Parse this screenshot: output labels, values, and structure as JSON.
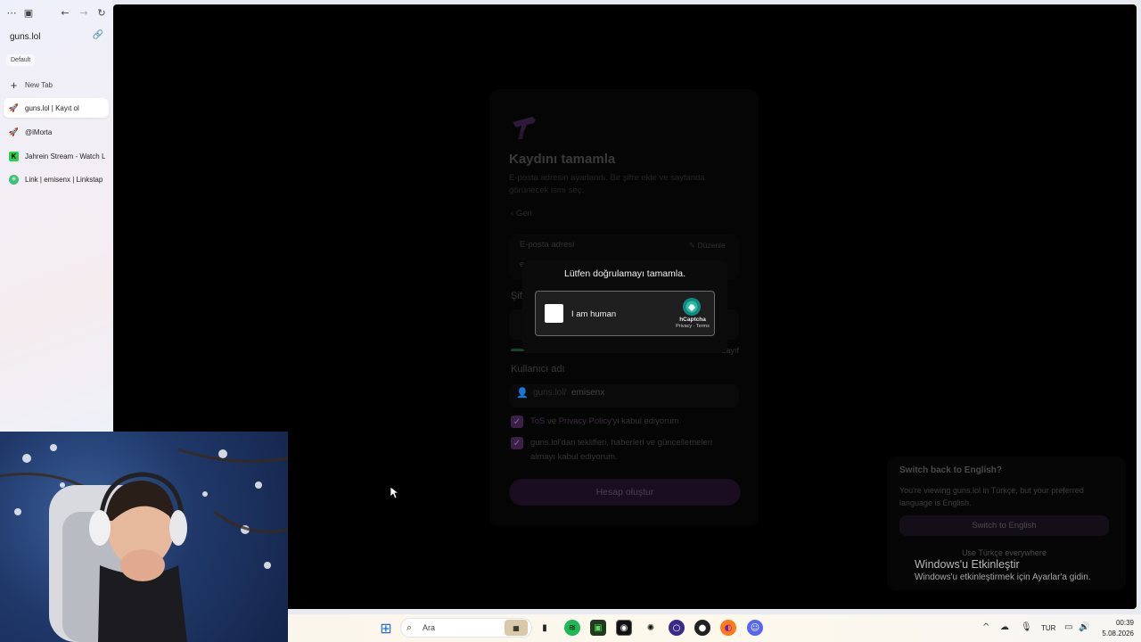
{
  "browser": {
    "address": "guns.lol",
    "profile": "Default",
    "new_tab": "New Tab",
    "tabs": [
      {
        "label": "guns.lol | Kayıt ol",
        "icon": "rocket-icon",
        "active": true
      },
      {
        "label": "@iMorta",
        "icon": "rocket-icon",
        "active": false
      },
      {
        "label": "Jahrein Stream - Watch L",
        "icon": "kick-icon",
        "active": false
      },
      {
        "label": "Link | emisenx | Linkstap",
        "icon": "linktree-icon",
        "active": false
      }
    ]
  },
  "signup": {
    "title": "Kaydını tamamla",
    "subtitle": "E-posta adresin ayarlandı. Bir şifre ekle ve sayfanda görünecek ismi seç.",
    "back": "Geri",
    "email_label": "E-posta adresi",
    "edit": "Düzenle",
    "email_value": "e",
    "password_label": "Şif",
    "strength_text": "Zayıf",
    "username_label": "Kullanıcı adı",
    "username_prefix": "guns.lol/",
    "username_value": "emisenx",
    "tos_1": "ToS",
    "tos_and": "ve",
    "tos_2": "Privacy Policy",
    "tos_rest": "'yi kabul ediyorum",
    "marketing": "guns.lol'dan teklifleri, haberleri ve güncellemeleri almayı kabul ediyorum.",
    "create_button": "Hesap oluştur"
  },
  "captcha": {
    "title": "Lütfen doğrulamayı tamamla.",
    "checkbox_label": "I am human",
    "brand": "hCaptcha",
    "links": "Privacy · Terms"
  },
  "language_toast": {
    "title": "Switch back to English?",
    "body": "You're viewing guns.lol in Türkçe, but your preferred language is English.",
    "switch_button": "Switch to English",
    "keep": "Use Türkçe everywhere"
  },
  "windows_activation": {
    "line1": "Windows'u Etkinleştir",
    "line2": "Windows'u etkinleştirmek için Ayarlar'a gidin."
  },
  "taskbar": {
    "search_placeholder": "Ara",
    "language": "TUR",
    "time": "00:39",
    "date": "5.08.2026"
  },
  "colors": {
    "accent_purple": "#3a2046",
    "page_bg": "#000000",
    "spotify_green": "#1db954"
  }
}
